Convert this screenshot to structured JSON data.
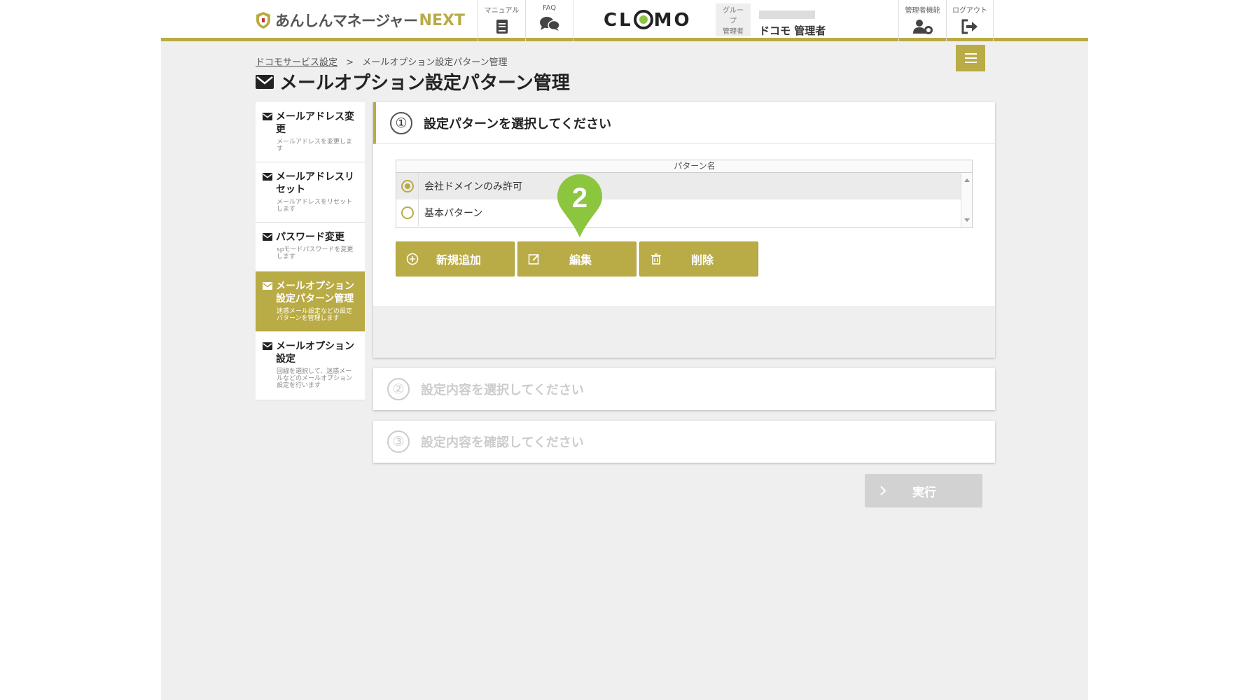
{
  "header": {
    "logo_text": "あんしんマネージャー",
    "logo_next": "NEXT",
    "manual_label": "マニュアル",
    "faq_label": "FAQ",
    "clomo_text": "CLOMO",
    "group_tag": "グループ",
    "admin_tag": "管理者",
    "user_name": "ドコモ 管理者",
    "admin_func_label": "管理者機能",
    "logout_label": "ログアウト"
  },
  "breadcrumb": {
    "parent": "ドコモサービス設定",
    "sep": ">",
    "current": "メールオプション設定パターン管理"
  },
  "page_title": "メールオプション設定パターン管理",
  "sidebar": {
    "items": [
      {
        "title": "メールアドレス変更",
        "desc": "メールアドレスを変更します"
      },
      {
        "title": "メールアドレスリセット",
        "desc": "メールアドレスをリセットします"
      },
      {
        "title": "パスワード変更",
        "desc": "spモードパスワードを変更します"
      },
      {
        "title": "メールオプション設定パターン管理",
        "desc": "迷惑メール設定などの設定パターンを管理します"
      },
      {
        "title": "メールオプション設定",
        "desc": "回線を選択して、迷惑メールなどのメールオプション設定を行います"
      }
    ]
  },
  "step1": {
    "number": "①",
    "title": "設定パターンを選択してください",
    "table": {
      "header": "パターン名",
      "rows": [
        {
          "name": "会社ドメインのみ許可",
          "selected": true
        },
        {
          "name": "基本パターン",
          "selected": false
        }
      ]
    },
    "buttons": {
      "add": "新規追加",
      "edit": "編集",
      "delete": "削除"
    }
  },
  "step2": {
    "number": "②",
    "title": "設定内容を選択してください"
  },
  "step3": {
    "number": "③",
    "title": "設定内容を確認してください"
  },
  "execute_label": "実行",
  "marker_number": "2",
  "colors": {
    "accent": "#b9ab45",
    "marker": "#8cc63f",
    "disabled": "#d2d2d2"
  }
}
